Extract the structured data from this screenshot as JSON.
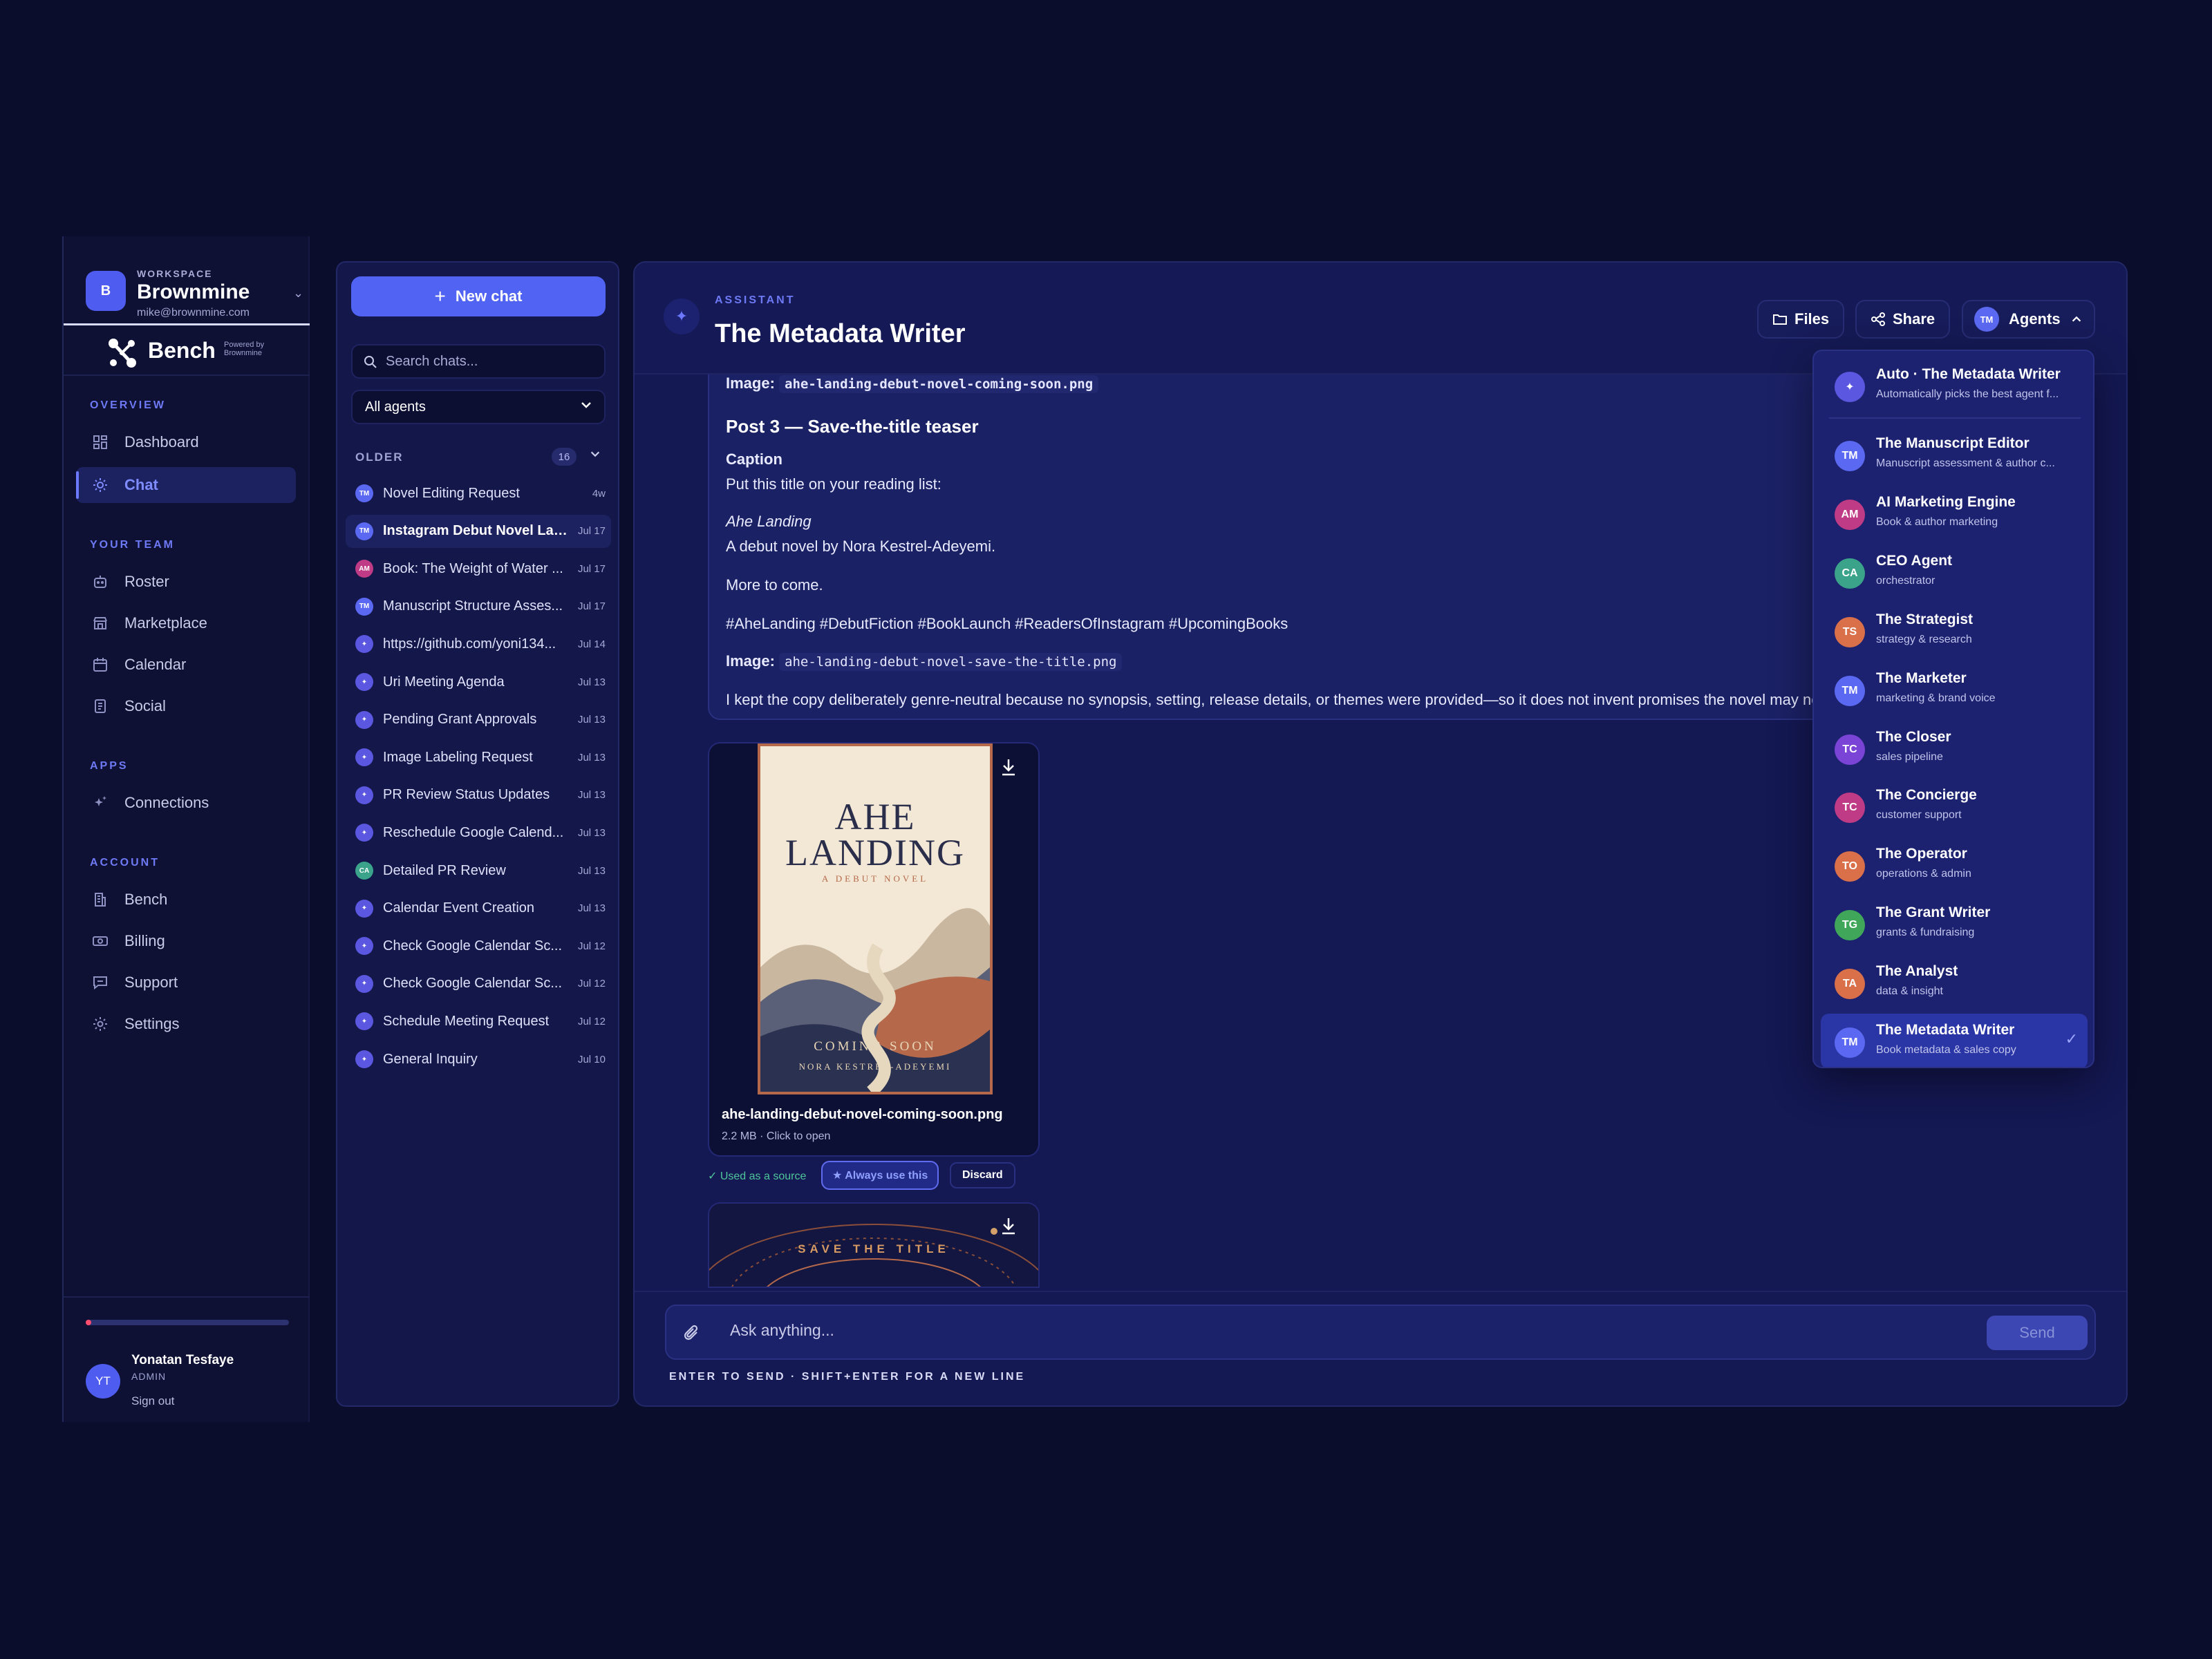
{
  "workspace": {
    "label": "WORKSPACE",
    "name": "Brownmine",
    "email": "mike@brownmine.com",
    "logo_letter": "B"
  },
  "brand": {
    "name": "Bench",
    "powered_by_1": "Powered by",
    "powered_by_2": "Brownmine"
  },
  "nav": {
    "overview_label": "OVERVIEW",
    "dashboard": "Dashboard",
    "chat": "Chat",
    "team_label": "YOUR TEAM",
    "roster": "Roster",
    "marketplace": "Marketplace",
    "calendar": "Calendar",
    "social": "Social",
    "apps_label": "APPS",
    "connections": "Connections",
    "account_label": "ACCOUNT",
    "bench": "Bench",
    "billing": "Billing",
    "support": "Support",
    "settings": "Settings"
  },
  "user": {
    "initials": "YT",
    "name": "Yonatan Tesfaye",
    "role": "ADMIN",
    "sign_out": "Sign out"
  },
  "chatlist": {
    "new_chat": "New chat",
    "search_placeholder": "Search chats...",
    "agent_filter": "All agents",
    "older_label": "OLDER",
    "older_count": "16",
    "items": [
      {
        "title": "Novel Editing Request",
        "date": "4w",
        "initials": "TM",
        "color": "#5b69f2"
      },
      {
        "title": "Instagram Debut Novel Lau...",
        "date": "Jul 17",
        "initials": "TM",
        "color": "#5b69f2",
        "active": true
      },
      {
        "title": "Book: The Weight of Water ...",
        "date": "Jul 17",
        "initials": "AM",
        "color": "#c03b86"
      },
      {
        "title": "Manuscript Structure Asses...",
        "date": "Jul 17",
        "initials": "TM",
        "color": "#5b69f2"
      },
      {
        "title": "https://github.com/yoni134...",
        "date": "Jul 14",
        "initials": "✦",
        "color": "#5b57e0"
      },
      {
        "title": "Uri Meeting Agenda",
        "date": "Jul 13",
        "initials": "✦",
        "color": "#5b57e0"
      },
      {
        "title": "Pending Grant Approvals",
        "date": "Jul 13",
        "initials": "✦",
        "color": "#5b57e0"
      },
      {
        "title": "Image Labeling Request",
        "date": "Jul 13",
        "initials": "✦",
        "color": "#5b57e0"
      },
      {
        "title": "PR Review Status Updates",
        "date": "Jul 13",
        "initials": "✦",
        "color": "#5b57e0"
      },
      {
        "title": "Reschedule Google Calend...",
        "date": "Jul 13",
        "initials": "✦",
        "color": "#5b57e0"
      },
      {
        "title": "Detailed PR Review",
        "date": "Jul 13",
        "initials": "CA",
        "color": "#3aa38a"
      },
      {
        "title": "Calendar Event Creation",
        "date": "Jul 13",
        "initials": "✦",
        "color": "#5b57e0"
      },
      {
        "title": "Check Google Calendar Sc...",
        "date": "Jul 12",
        "initials": "✦",
        "color": "#5b57e0"
      },
      {
        "title": "Check Google Calendar Sc...",
        "date": "Jul 12",
        "initials": "✦",
        "color": "#5b57e0"
      },
      {
        "title": "Schedule Meeting Request",
        "date": "Jul 12",
        "initials": "✦",
        "color": "#5b57e0"
      },
      {
        "title": "General Inquiry",
        "date": "Jul 10",
        "initials": "✦",
        "color": "#5b57e0"
      }
    ]
  },
  "header": {
    "assistant_label": "ASSISTANT",
    "title": "The Metadata Writer",
    "files": "Files",
    "share": "Share",
    "agents": "Agents",
    "agents_initials": "TM"
  },
  "message": {
    "top_image_label": "Image:",
    "top_image_file": "ahe-landing-debut-novel-coming-soon.png",
    "post_heading": "Post 3 — Save-the-title teaser",
    "caption_label": "Caption",
    "caption_line1": "Put this title on your reading list:",
    "caption_title": "Ahe Landing",
    "caption_line2": "A debut novel by Nora Kestrel-Adeyemi.",
    "caption_line3": "More to come.",
    "hashtags": "#AheLanding #DebutFiction #BookLaunch #ReadersOfInstagram #UpcomingBooks",
    "image_label": "Image:",
    "image_file": "ahe-landing-debut-novel-save-the-title.png",
    "note": "I kept the copy deliberately genre-neutral because no synopsis, setting, release details, or themes were provided—so it does not invent promises the novel may not"
  },
  "attachment": {
    "cover_title_1": "AHE",
    "cover_title_2": "LANDING",
    "cover_subtitle": "A DEBUT NOVEL",
    "cover_coming": "COMING SOON",
    "cover_author": "NORA KESTREL-ADEYEMI",
    "filename": "ahe-landing-debut-novel-coming-soon.png",
    "meta": "2.2 MB · Click to open",
    "used_source": "✓ Used as a source",
    "always_use": "★ Always use this",
    "discard": "Discard",
    "second_preview_text": "SAVE THE TITLE"
  },
  "composer": {
    "placeholder": "Ask anything...",
    "send": "Send",
    "hint": "ENTER TO SEND · SHIFT+ENTER FOR A NEW LINE"
  },
  "agent_menu": {
    "items": [
      {
        "initials": "✦",
        "name": "Auto · The Metadata Writer",
        "desc": "Automatically picks the best agent f...",
        "color": "#5b57e0"
      },
      {
        "initials": "TM",
        "name": "The Manuscript Editor",
        "desc": "Manuscript assessment & author c...",
        "color": "#5b69f2"
      },
      {
        "initials": "AM",
        "name": "AI Marketing Engine",
        "desc": "Book & author marketing",
        "color": "#c03b86"
      },
      {
        "initials": "CA",
        "name": "CEO Agent",
        "desc": "orchestrator",
        "color": "#3aa38a"
      },
      {
        "initials": "TS",
        "name": "The Strategist",
        "desc": "strategy & research",
        "color": "#d9704a"
      },
      {
        "initials": "TM",
        "name": "The Marketer",
        "desc": "marketing & brand voice",
        "color": "#5b69f2"
      },
      {
        "initials": "TC",
        "name": "The Closer",
        "desc": "sales pipeline",
        "color": "#7a45d6"
      },
      {
        "initials": "TC",
        "name": "The Concierge",
        "desc": "customer support",
        "color": "#c03b86"
      },
      {
        "initials": "TO",
        "name": "The Operator",
        "desc": "operations & admin",
        "color": "#d9704a"
      },
      {
        "initials": "TG",
        "name": "The Grant Writer",
        "desc": "grants & fundraising",
        "color": "#3fa65a"
      },
      {
        "initials": "TA",
        "name": "The Analyst",
        "desc": "data & insight",
        "color": "#d9704a"
      },
      {
        "initials": "TM",
        "name": "The Metadata Writer",
        "desc": "Book metadata & sales copy",
        "color": "#5b69f2",
        "selected": true
      }
    ]
  }
}
